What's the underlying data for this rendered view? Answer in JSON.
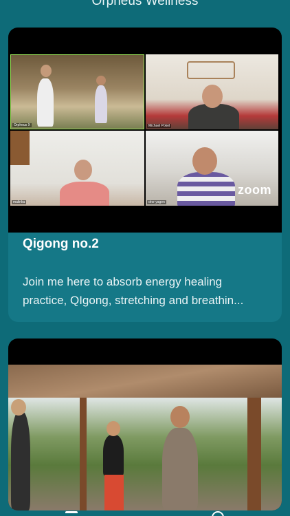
{
  "app": {
    "title": "Orpheus Wellness"
  },
  "cards": [
    {
      "title": "Qigong no.2",
      "description_lines": [
        "Join me here to absorb energy healing",
        "practice, QIgong, stretching and breathin..."
      ],
      "participants": [
        "Orpheus X",
        "Michael Pokel",
        "malinka",
        "dror yagen"
      ],
      "watermark": "zoom"
    },
    {
      "title": "",
      "description_lines": []
    }
  ],
  "nav": {
    "icons": [
      "menu-icon",
      "account-icon"
    ]
  }
}
